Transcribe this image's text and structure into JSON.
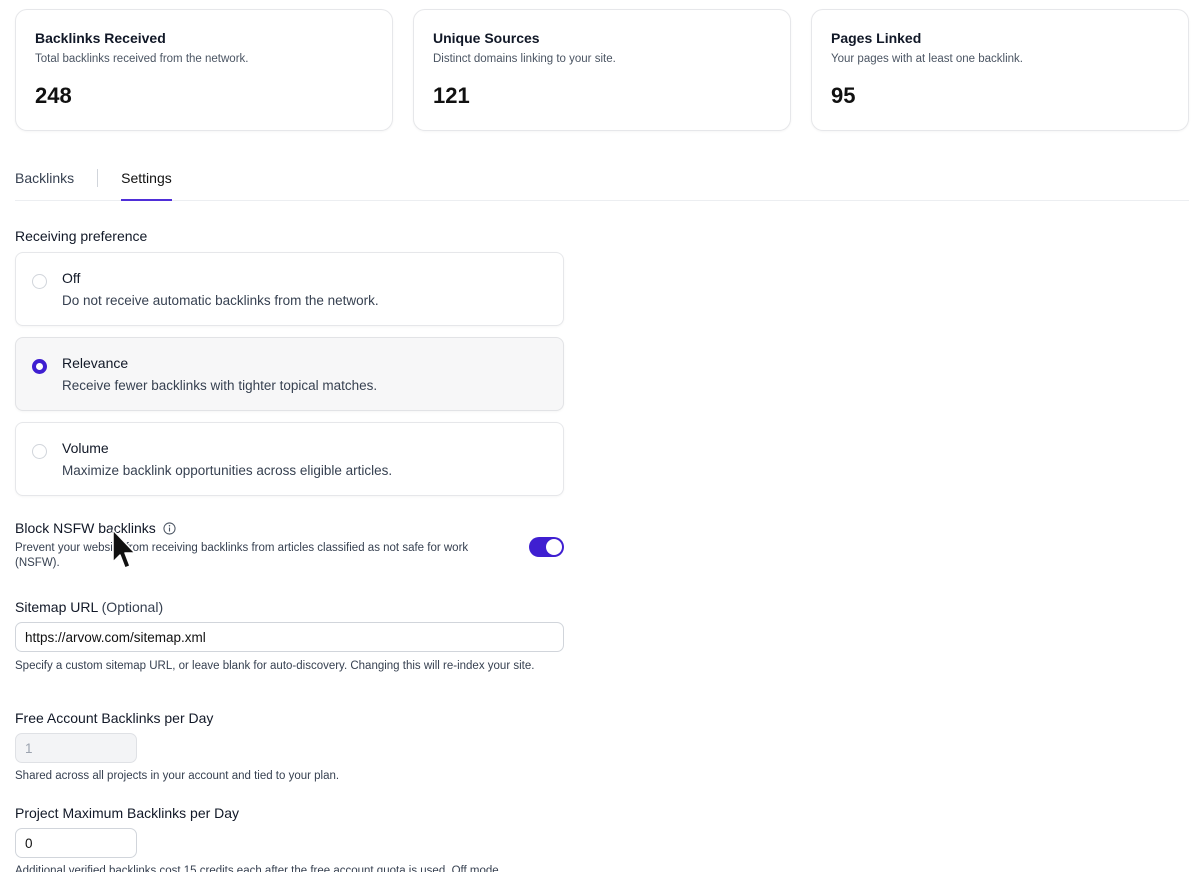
{
  "stats": [
    {
      "title": "Backlinks Received",
      "desc": "Total backlinks received from the network.",
      "value": "248"
    },
    {
      "title": "Unique Sources",
      "desc": "Distinct domains linking to your site.",
      "value": "121"
    },
    {
      "title": "Pages Linked",
      "desc": "Your pages with at least one backlink.",
      "value": "95"
    }
  ],
  "tabs": [
    {
      "label": "Backlinks",
      "active": false
    },
    {
      "label": "Settings",
      "active": true
    }
  ],
  "receiving": {
    "label": "Receiving preference",
    "options": [
      {
        "title": "Off",
        "desc": "Do not receive automatic backlinks from the network.",
        "selected": false
      },
      {
        "title": "Relevance",
        "desc": "Receive fewer backlinks with tighter topical matches.",
        "selected": true
      },
      {
        "title": "Volume",
        "desc": "Maximize backlink opportunities across eligible articles.",
        "selected": false
      }
    ]
  },
  "nsfw": {
    "title": "Block NSFW backlinks",
    "desc": "Prevent your website from receiving backlinks from articles classified as not safe for work (NSFW).",
    "enabled": true,
    "info_icon": "info-icon"
  },
  "sitemap": {
    "label": "Sitemap URL",
    "optional": "(Optional)",
    "value": "https://arvow.com/sitemap.xml",
    "help": "Specify a custom sitemap URL, or leave blank for auto-discovery. Changing this will re-index your site."
  },
  "free_backlinks": {
    "label": "Free Account Backlinks per Day",
    "value": "1",
    "help": "Shared across all projects in your account and tied to your plan."
  },
  "project_max": {
    "label": "Project Maximum Backlinks per Day",
    "value": "0",
    "help": "Additional verified backlinks cost 15 credits each after the free account quota is used. Off mode"
  },
  "colors": {
    "accent": "#3f1fd1",
    "border": "#e6e7ea"
  }
}
